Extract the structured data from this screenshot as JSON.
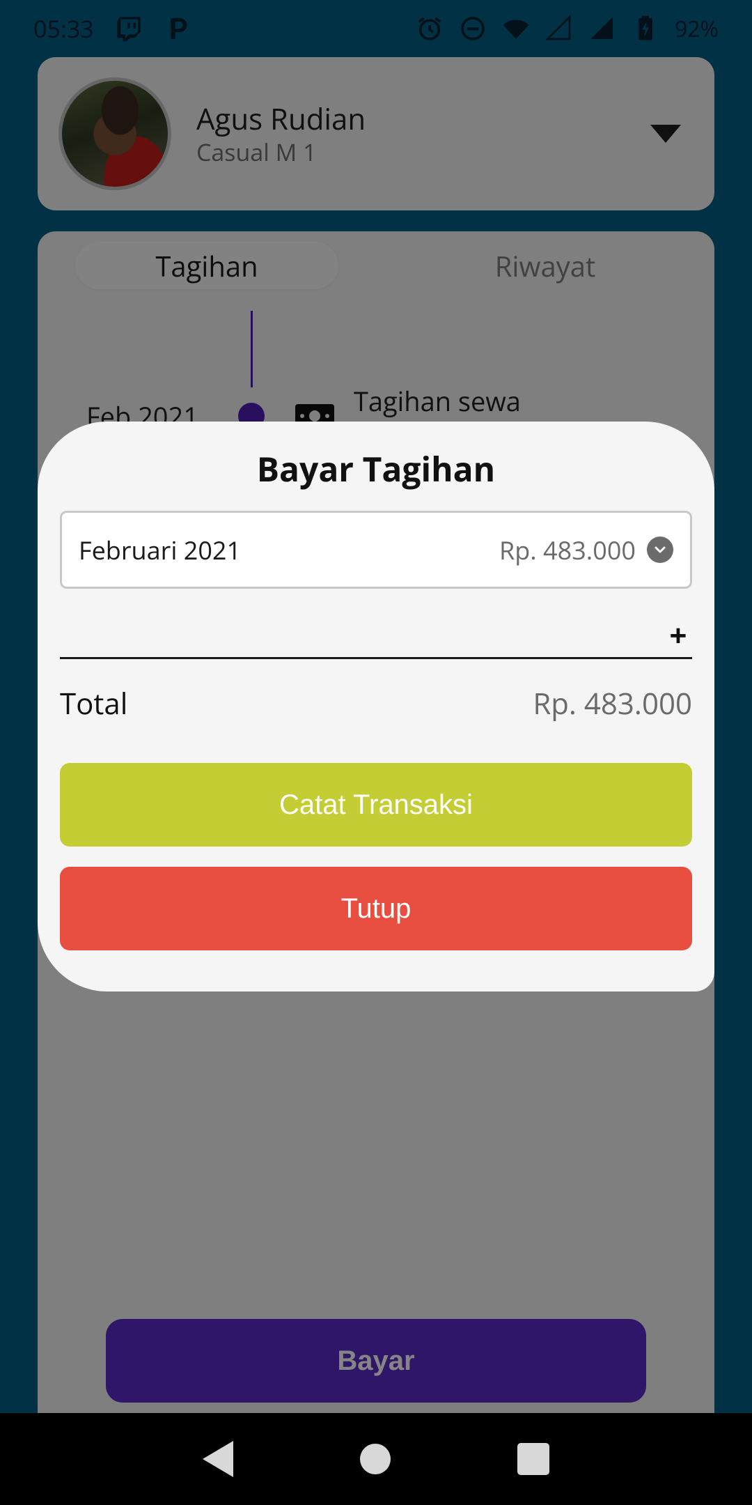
{
  "status_bar": {
    "time": "05:33",
    "battery": "92%",
    "icons": [
      "twitch-icon",
      "p-app-icon",
      "alarm-icon",
      "dnd-icon",
      "wifi-icon",
      "signal-empty-icon",
      "signal-icon",
      "battery-icon"
    ]
  },
  "profile": {
    "name": "Agus Rudian",
    "subtitle": "Casual M 1"
  },
  "tabs": [
    {
      "label": "Tagihan"
    },
    {
      "label": "Riwayat"
    }
  ],
  "timeline": {
    "date": "Feb 2021",
    "title": "Tagihan sewa"
  },
  "bayar_button": "Bayar",
  "modal": {
    "title": "Bayar Tagihan",
    "select": {
      "month": "Februari 2021",
      "amount": "Rp. 483.000"
    },
    "add_symbol": "+",
    "total_label": "Total",
    "total_value": "Rp. 483.000",
    "catat_label": "Catat Transaksi",
    "tutup_label": "Tutup"
  },
  "colors": {
    "primary_blue": "#005f84",
    "purple": "#5a2bc8",
    "lime": "#c4cd34",
    "red": "#e84e3f"
  }
}
